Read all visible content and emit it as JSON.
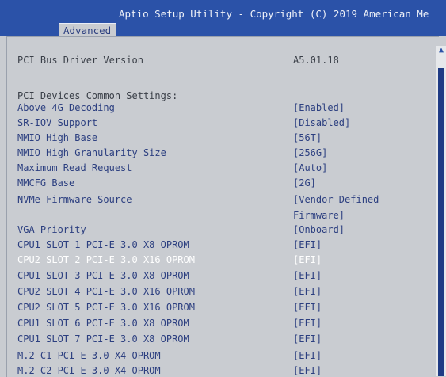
{
  "header": {
    "title": "Aptio Setup Utility - Copyright (C) 2019 American Me",
    "tab": "Advanced"
  },
  "scrollbar": {
    "up_glyph": "▲"
  },
  "rows": [
    {
      "label": "PCI Bus Driver Version",
      "value": "A5.01.18",
      "kind": "static"
    },
    {
      "label": "PCI Devices Common Settings:",
      "value": "",
      "kind": "static"
    },
    {
      "label": "Above 4G Decoding",
      "value": "[Enabled]",
      "kind": "menu"
    },
    {
      "label": "SR-IOV Support",
      "value": "[Disabled]",
      "kind": "menu"
    },
    {
      "label": "MMIO High Base",
      "value": "[56T]",
      "kind": "menu"
    },
    {
      "label": "MMIO High Granularity Size",
      "value": "[256G]",
      "kind": "menu"
    },
    {
      "label": "Maximum Read Request",
      "value": "[Auto]",
      "kind": "menu"
    },
    {
      "label": "MMCFG Base",
      "value": "[2G]",
      "kind": "menu"
    },
    {
      "label": "NVMe Firmware Source",
      "value": "[Vendor Defined",
      "kind": "menu"
    },
    {
      "label": "",
      "value": "Firmware]",
      "kind": "menu"
    },
    {
      "label": "VGA Priority",
      "value": "[Onboard]",
      "kind": "menu"
    },
    {
      "label": "CPU1 SLOT 1 PCI-E 3.0 X8 OPROM",
      "value": "[EFI]",
      "kind": "menu"
    },
    {
      "label": "CPU2 SLOT 2 PCI-E 3.0 X16 OPROM",
      "value": "[EFI]",
      "kind": "highlight"
    },
    {
      "label": "CPU1 SLOT 3 PCI-E 3.0 X8 OPROM",
      "value": "[EFI]",
      "kind": "menu"
    },
    {
      "label": "CPU2 SLOT 4 PCI-E 3.0 X16 OPROM",
      "value": "[EFI]",
      "kind": "menu"
    },
    {
      "label": "CPU2 SLOT 5 PCI-E 3.0 X16 OPROM",
      "value": "[EFI]",
      "kind": "menu"
    },
    {
      "label": "CPU1 SLOT 6 PCI-E 3.0 X8 OPROM",
      "value": "[EFI]",
      "kind": "menu"
    },
    {
      "label": "CPU1 SLOT 7 PCI-E 3.0 X8 OPROM",
      "value": "[EFI]",
      "kind": "menu"
    },
    {
      "label": "M.2-C1 PCI-E 3.0 X4 OPROM",
      "value": "[EFI]",
      "kind": "menu"
    },
    {
      "label": "M.2-C2 PCI-E 3.0 X4 OPROM",
      "value": "[EFI]",
      "kind": "menu"
    }
  ]
}
